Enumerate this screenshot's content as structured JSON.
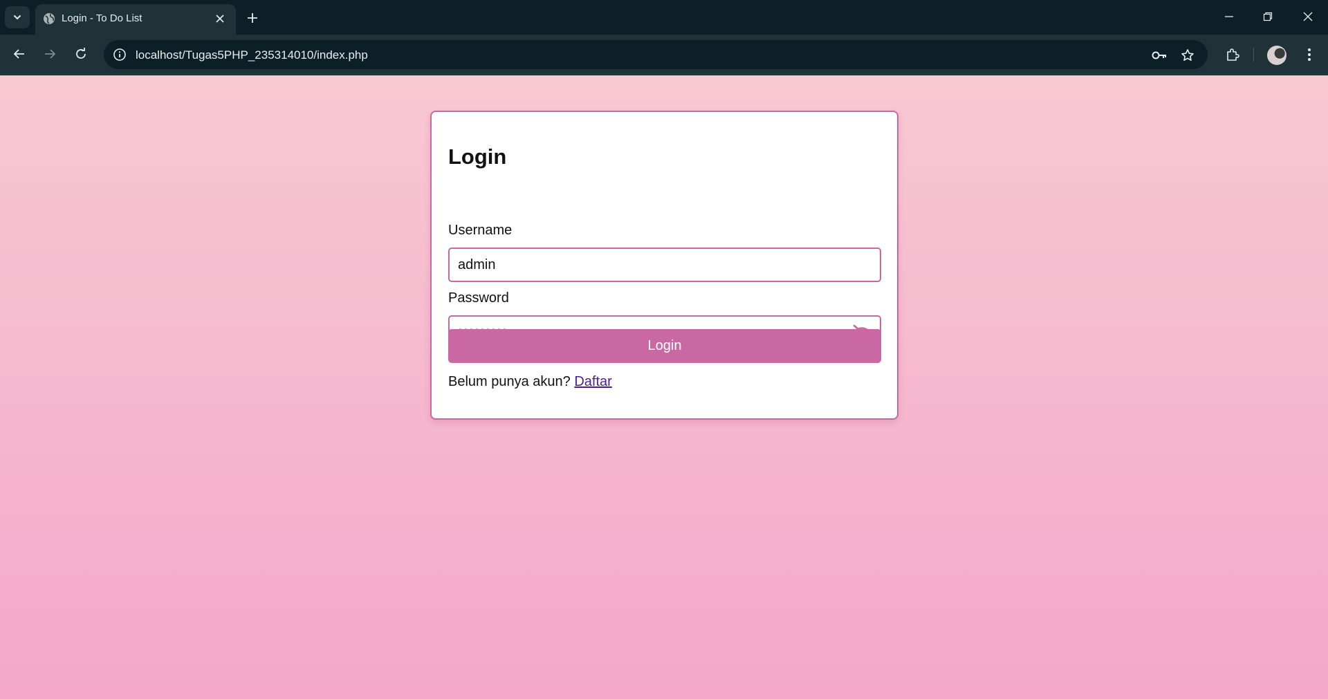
{
  "browser": {
    "tab_title": "Login - To Do List",
    "url": "localhost/Tugas5PHP_235314010/index.php",
    "icons": [
      "chevron-down-icon",
      "globe-icon",
      "close-icon",
      "plus-icon",
      "minimize-icon",
      "restore-icon",
      "back-arrow-icon",
      "forward-arrow-icon",
      "reload-icon",
      "info-icon",
      "key-icon",
      "star-icon",
      "extensions-icon",
      "avatar",
      "more-vert-icon"
    ]
  },
  "page": {
    "heading": "Login",
    "username_label": "Username",
    "username_value": "admin",
    "password_label": "Password",
    "password_masked": "•••••••••",
    "login_button": "Login",
    "register_prompt": "Belum punya akun?",
    "register_link": "Daftar"
  },
  "colors": {
    "accent": "#ca68a3",
    "border": "#c9679f",
    "link": "#4b1c96",
    "bg_top": "#f8c8d2",
    "bg_bottom": "#f3a8ca"
  }
}
